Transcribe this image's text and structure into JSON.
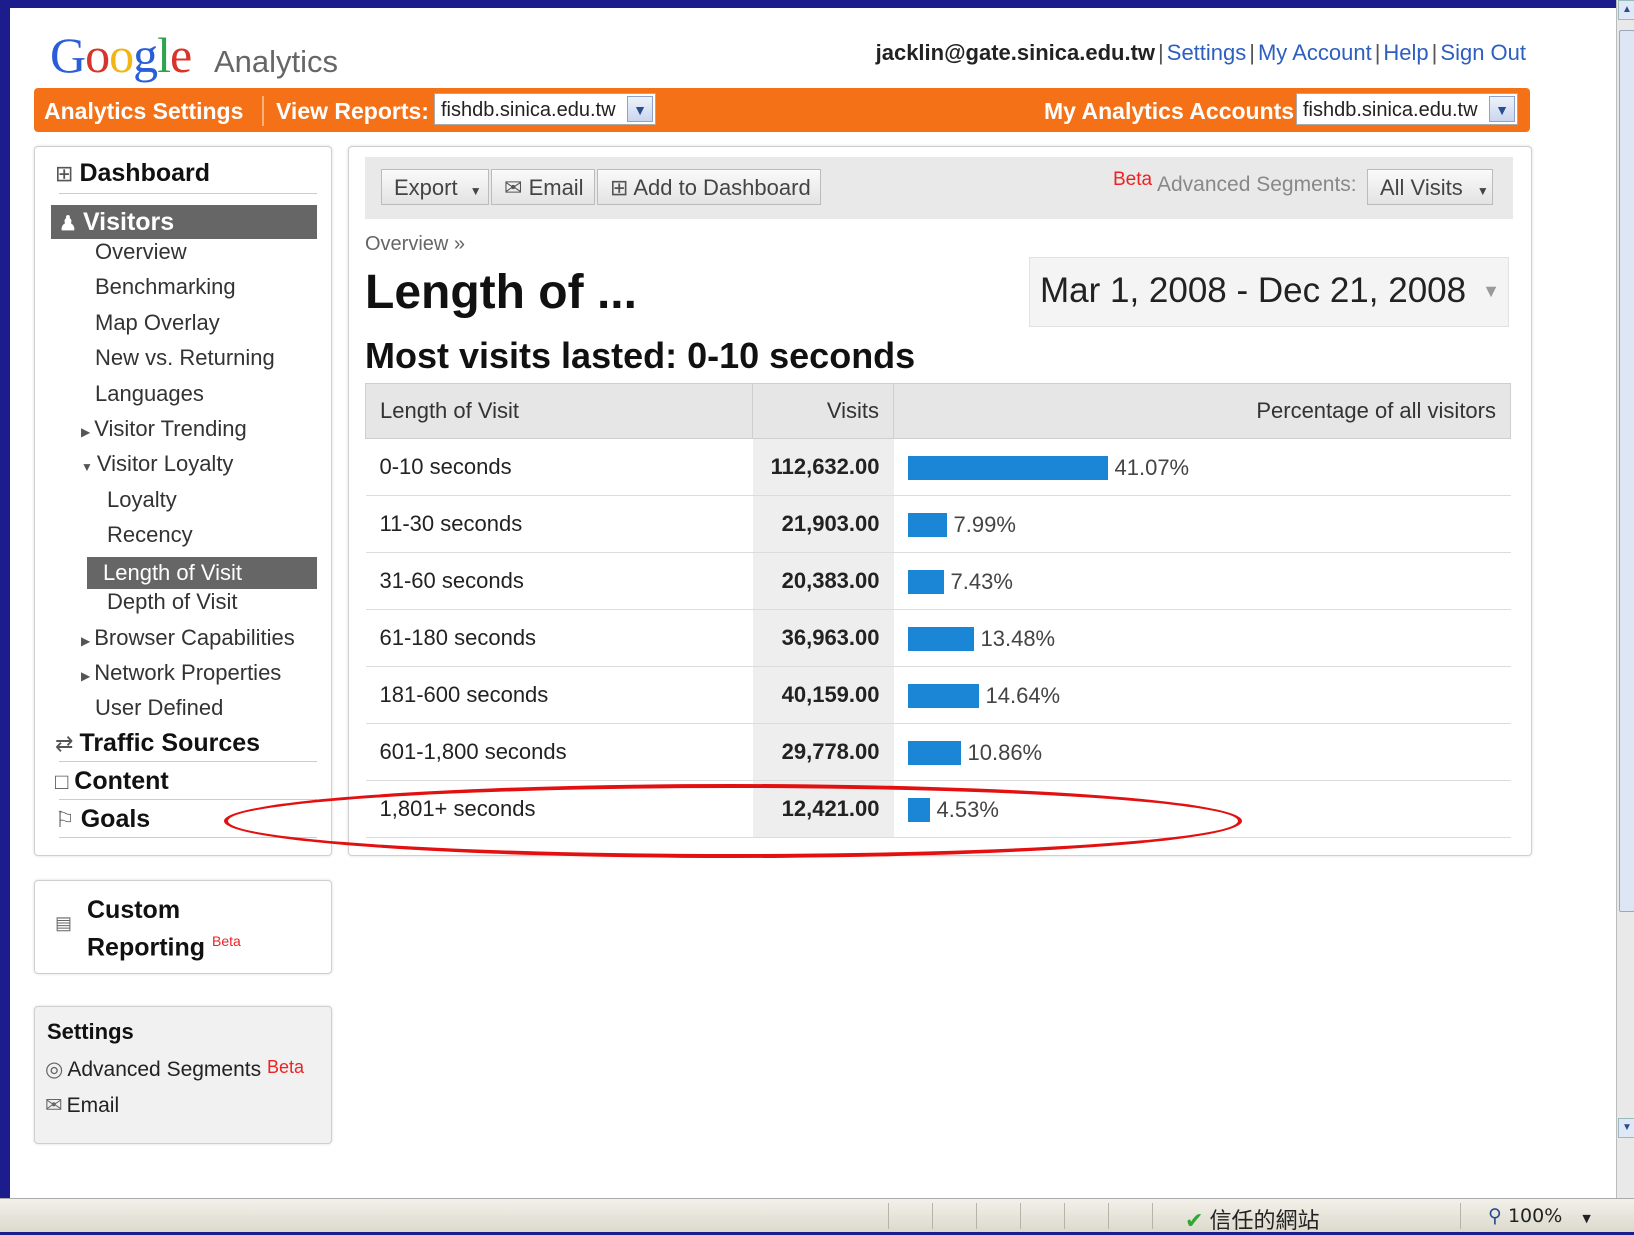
{
  "header": {
    "logo_google": "Google",
    "logo_analytics": "Analytics",
    "user": "jacklin@gate.sinica.edu.tw",
    "links": [
      "Settings",
      "My Account",
      "Help",
      "Sign Out"
    ]
  },
  "orangebar": {
    "analytics_settings": "Analytics Settings",
    "view_reports": "View Reports:",
    "view_reports_value": "fishdb.sinica.edu.tw",
    "accounts_label": "My Analytics Accounts:",
    "accounts_value": "fishdb.sinica.edu.tw"
  },
  "sidebar": {
    "dashboard": "Dashboard",
    "visitors": "Visitors",
    "items": [
      "Overview",
      "Benchmarking",
      "Map Overlay",
      "New vs. Returning",
      "Languages",
      "Visitor Trending",
      "Visitor Loyalty",
      "Loyalty",
      "Recency",
      "Length of Visit",
      "Depth of Visit",
      "Browser Capabilities",
      "Network Properties",
      "User Defined"
    ],
    "traffic_sources": "Traffic Sources",
    "content": "Content",
    "goals": "Goals"
  },
  "custom_reporting": {
    "line1": "Custom",
    "line2": "Reporting",
    "beta": "Beta"
  },
  "settings_box": {
    "title": "Settings",
    "advanced_segments": "Advanced Segments",
    "beta": "Beta",
    "email": "Email"
  },
  "toolbar": {
    "export": "Export",
    "email": "Email",
    "add_to_dashboard": "Add to Dashboard",
    "beta": "Beta",
    "segments_label": "Advanced Segments:",
    "segments_value": "All Visits"
  },
  "report": {
    "breadcrumb": "Overview »",
    "title": "Length of ...",
    "subtitle": "Most visits lasted: 0-10 seconds",
    "date_range": "Mar 1, 2008 - Dec 21, 2008",
    "columns": [
      "Length of Visit",
      "Visits",
      "Percentage of all visitors"
    ],
    "rows": [
      {
        "length": "0-10 seconds",
        "visits": "112,632.00",
        "pct": "41.07%",
        "fraction": 0.4107
      },
      {
        "length": "11-30 seconds",
        "visits": "21,903.00",
        "pct": "7.99%",
        "fraction": 0.0799
      },
      {
        "length": "31-60 seconds",
        "visits": "20,383.00",
        "pct": "7.43%",
        "fraction": 0.0743
      },
      {
        "length": "61-180 seconds",
        "visits": "36,963.00",
        "pct": "13.48%",
        "fraction": 0.1348
      },
      {
        "length": "181-600 seconds",
        "visits": "40,159.00",
        "pct": "14.64%",
        "fraction": 0.1464
      },
      {
        "length": "601-1,800 seconds",
        "visits": "29,778.00",
        "pct": "10.86%",
        "fraction": 0.1086
      },
      {
        "length": "1,801+ seconds",
        "visits": "12,421.00",
        "pct": "4.53%",
        "fraction": 0.0453
      }
    ]
  },
  "statusbar": {
    "trusted": "信任的網站",
    "zoom": "100%"
  },
  "colors": {
    "orange": "#f57117",
    "bar": "#1b86d6",
    "highlight": "#e21010"
  }
}
